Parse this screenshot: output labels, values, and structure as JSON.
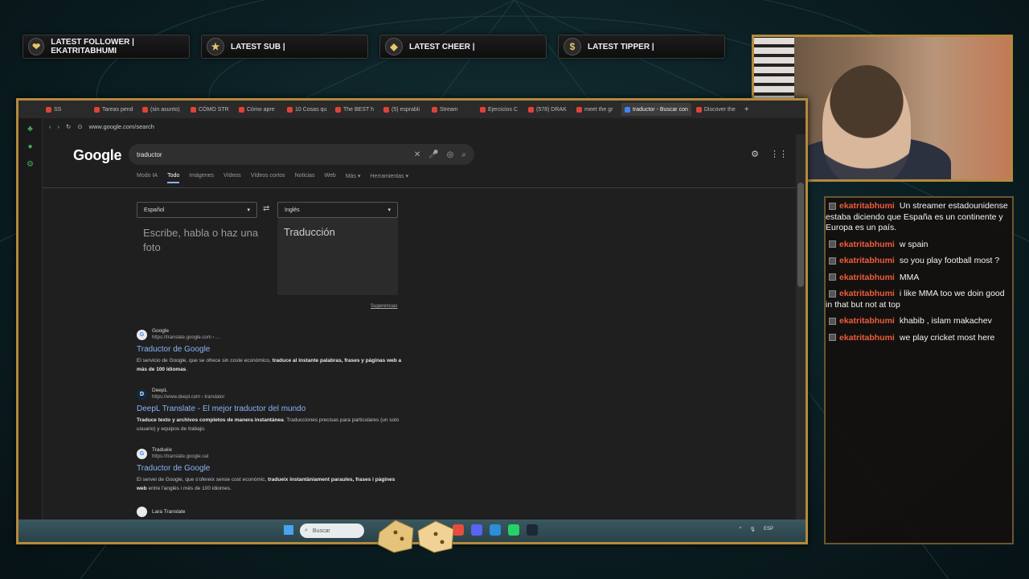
{
  "alerts": [
    {
      "icon": "heart-icon",
      "glyph": "❤",
      "label": "LATEST FOLLOWER | EKATRITABHUMI"
    },
    {
      "icon": "star-icon",
      "glyph": "★",
      "label": "LATEST SUB |"
    },
    {
      "icon": "diamond-icon",
      "glyph": "◆",
      "label": "LATEST CHEER |"
    },
    {
      "icon": "dollar-icon",
      "glyph": "$",
      "label": "LATEST TIPPER |"
    }
  ],
  "browser": {
    "tabs": [
      "SS",
      "Tareas pend",
      "(sin asunto)",
      "CÓMO STR",
      "Cómo apre",
      "10 Cosas qu",
      "The BEST h",
      "(5) esprabli",
      "Stream",
      "Ejercicios C",
      "(578) DRAK",
      "meet the gr",
      "traductor - Buscar con",
      "Discover the"
    ],
    "active_tab": 12,
    "url": "www.google.com/search"
  },
  "google": {
    "logo": "Google",
    "query": "traductor",
    "nav": [
      "Modo IA",
      "Todo",
      "Imágenes",
      "Vídeos",
      "Vídeos cortos",
      "Noticias",
      "Web",
      "Más ▾",
      "Herramientas ▾"
    ],
    "nav_active": 1,
    "translate": {
      "source_lang": "Español",
      "target_lang": "Inglés",
      "input_placeholder": "Escribe, habla o haz una foto",
      "output_placeholder": "Traducción",
      "suggestions": "Sugerencias"
    },
    "results": [
      {
        "site": "Google",
        "url": "https://translate.google.com › ...",
        "title": "Traductor de Google",
        "snippet_pre": "El servicio de Google, que se ofrece sin coste económico, ",
        "snippet_bold": "traduce al instante palabras, frases y páginas web a más de 100 idiomas",
        "snippet_post": "."
      },
      {
        "site": "DeepL",
        "url": "https://www.deepl.com › translator",
        "title": "DeepL Translate - El mejor traductor del mundo",
        "snippet_pre": "",
        "snippet_bold": "Traduce texto y archivos completos de manera instantánea",
        "snippet_post": ". Traducciones precisas para particulares (un solo usuario) y equipos de trabajo."
      },
      {
        "site": "Traduéix",
        "url": "https://translate.google.cat",
        "title": "Traductor de Google",
        "snippet_pre": "El servei de Google, que s'ofereix sense cost econòmic, ",
        "snippet_bold": "tradueix instantàniament paraules, frases i pàgines web",
        "snippet_post": " entre l'anglès i més de 100 idiomes."
      }
    ],
    "next_result_site": "Lara Translate"
  },
  "taskbar": {
    "search_label": "Buscar",
    "tray": [
      "ESP"
    ]
  },
  "chat": {
    "user_color": "#ee5c3a",
    "messages": [
      {
        "user": "ekatritabhumi",
        "text": "Un streamer estadounidense estaba diciendo que España es un continente y Europa es un país."
      },
      {
        "user": "ekatritabhumi",
        "text": "w spain"
      },
      {
        "user": "ekatritabhumi",
        "text": "so you play football most ?"
      },
      {
        "user": "ekatritabhumi",
        "text": "MMA"
      },
      {
        "user": "ekatritabhumi",
        "text": "i like MMA too we doin good in that but not at top"
      },
      {
        "user": "ekatritabhumi",
        "text": "khabib , islam makachev"
      },
      {
        "user": "ekatritabhumi",
        "text": "we play cricket most here"
      }
    ]
  },
  "colors": {
    "frame_gold": "#b48a3c",
    "link_blue": "#8ab4f8",
    "bg_teal": "#0b1f23"
  }
}
